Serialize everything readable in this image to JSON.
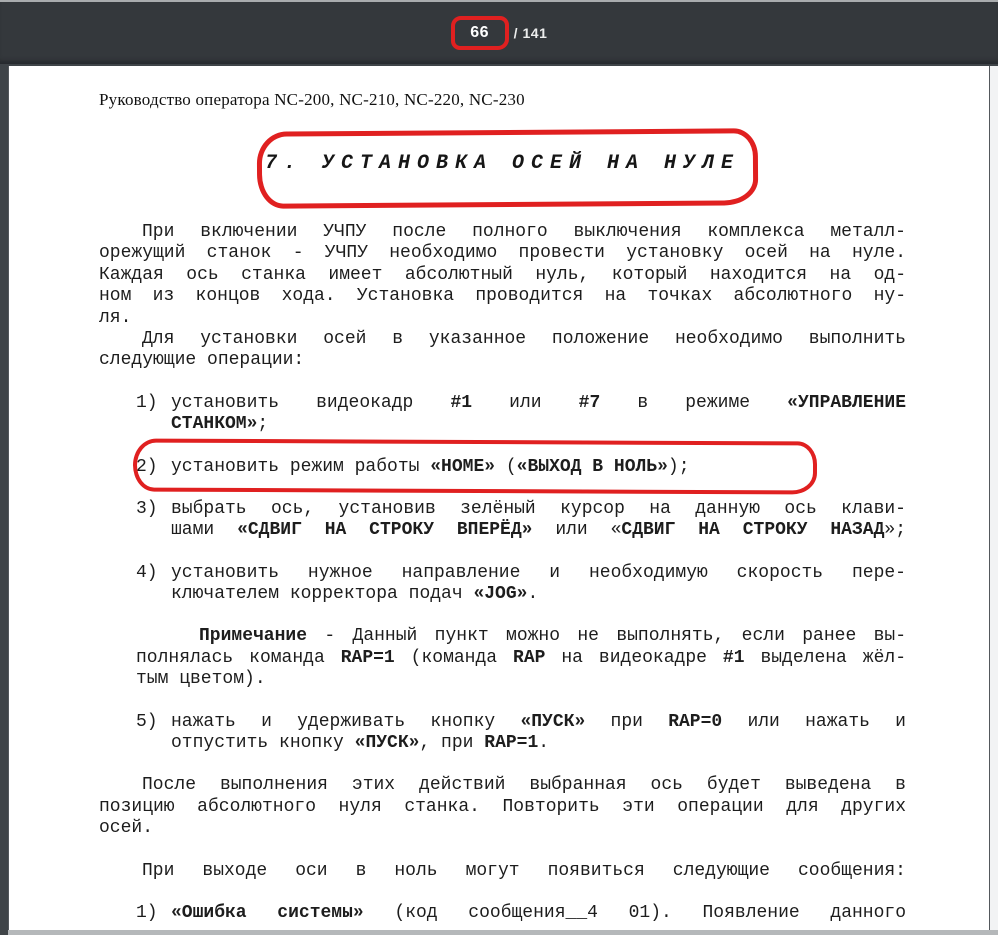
{
  "toolbar": {
    "current_page": "66",
    "page_separator": "/",
    "total_pages": "141"
  },
  "annotation_color": "#e02020",
  "page": {
    "header": "Руководство оператора NC-200, NC-210, NC-220, NC-230",
    "title": "7.  УСТАНОВКА ОСЕЙ НА НУЛЕ",
    "blocks": [
      {
        "type": "para",
        "indent": true,
        "gap": false,
        "lines": [
          {
            "j": true,
            "r": [
              [
                "При включении УЧПУ после полного выключения комплекса металл-",
                0
              ]
            ]
          },
          {
            "j": true,
            "r": [
              [
                "орежущий станок - УЧПУ необходимо провести установку осей на нуле.",
                0
              ]
            ]
          },
          {
            "j": true,
            "r": [
              [
                "Каждая ось станка имеет абсолютный нуль, который находится на од-",
                0
              ]
            ]
          },
          {
            "j": true,
            "r": [
              [
                "ном из концов хода. Установка проводится на точках абсолютного ну-",
                0
              ]
            ]
          },
          {
            "j": false,
            "r": [
              [
                "ля.",
                0
              ]
            ]
          }
        ]
      },
      {
        "type": "para",
        "indent": true,
        "gap": false,
        "lines": [
          {
            "j": true,
            "r": [
              [
                "Для установки осей в указанное положение необходимо выполнить",
                0
              ]
            ]
          },
          {
            "j": false,
            "r": [
              [
                "следующие операции:",
                0
              ]
            ]
          }
        ]
      },
      {
        "type": "list",
        "marker": "1)",
        "gap": true,
        "lines": [
          {
            "j": true,
            "r": [
              [
                "установить видеокадр ",
                0
              ],
              [
                "#1",
                1
              ],
              [
                " или ",
                0
              ],
              [
                "#7",
                1
              ],
              [
                " в режиме ",
                0
              ],
              [
                "«УПРАВЛЕНИЕ",
                1
              ]
            ]
          },
          {
            "j": false,
            "r": [
              [
                "СТАНКОМ»",
                1
              ],
              [
                ";",
                0
              ]
            ]
          }
        ]
      },
      {
        "type": "list",
        "marker": "2)",
        "gap": true,
        "lines": [
          {
            "j": false,
            "r": [
              [
                "установить режим работы ",
                0
              ],
              [
                "«HOME»",
                1
              ],
              [
                " (",
                0
              ],
              [
                "«ВЫХОД В НОЛЬ»",
                1
              ],
              [
                ");",
                0
              ]
            ]
          }
        ]
      },
      {
        "type": "list",
        "marker": "3)",
        "gap": true,
        "lines": [
          {
            "j": true,
            "r": [
              [
                "выбрать ось, установив зелёный курсор на данную ось клави-",
                0
              ]
            ]
          },
          {
            "j": true,
            "r": [
              [
                "шами ",
                0
              ],
              [
                "«СДВИГ НА СТРОКУ ВПЕРЁД»",
                1
              ],
              [
                " или «",
                0
              ],
              [
                "СДВИГ НА СТРОКУ НАЗАД",
                1
              ],
              [
                "»;",
                0
              ]
            ]
          }
        ]
      },
      {
        "type": "list",
        "marker": "4)",
        "gap": true,
        "lines": [
          {
            "j": true,
            "r": [
              [
                "установить нужное направление и необходимую скорость пере-",
                0
              ]
            ]
          },
          {
            "j": false,
            "r": [
              [
                "ключателем корректора подач ",
                0
              ],
              [
                "«JOG»",
                1
              ],
              [
                ".",
                0
              ]
            ]
          }
        ]
      },
      {
        "type": "note",
        "gap": true,
        "lines": [
          {
            "j": true,
            "r": [
              [
                "Примечание",
                1
              ],
              [
                " - Данный пункт можно не выполнять, если ранее вы-",
                0
              ]
            ]
          },
          {
            "j": true,
            "r": [
              [
                "полнялась команда ",
                0
              ],
              [
                "RAP=1",
                1
              ],
              [
                " (команда ",
                0
              ],
              [
                "RAP",
                1
              ],
              [
                " на видеокадре ",
                0
              ],
              [
                "#1",
                1
              ],
              [
                " выделена жёл-",
                0
              ]
            ]
          },
          {
            "j": false,
            "r": [
              [
                "тым цветом).",
                0
              ]
            ]
          }
        ]
      },
      {
        "type": "list",
        "marker": "5)",
        "gap": true,
        "lines": [
          {
            "j": true,
            "r": [
              [
                "нажать и удерживать кнопку ",
                0
              ],
              [
                "«ПУСК»",
                1
              ],
              [
                " при ",
                0
              ],
              [
                "RAP=0",
                1
              ],
              [
                " или нажать и",
                0
              ]
            ]
          },
          {
            "j": false,
            "r": [
              [
                "отпустить кнопку ",
                0
              ],
              [
                "«ПУСК»",
                1
              ],
              [
                ", при ",
                0
              ],
              [
                "RAP=1",
                1
              ],
              [
                ".",
                0
              ]
            ]
          }
        ]
      },
      {
        "type": "para",
        "indent": true,
        "gap": true,
        "lines": [
          {
            "j": true,
            "r": [
              [
                "После выполнения этих действий выбранная ось будет выведена в",
                0
              ]
            ]
          },
          {
            "j": true,
            "r": [
              [
                "позицию абсолютного нуля станка. Повторить эти операции для других",
                0
              ]
            ]
          },
          {
            "j": false,
            "r": [
              [
                "осей.",
                0
              ]
            ]
          }
        ]
      },
      {
        "type": "para",
        "indent": true,
        "gap": true,
        "lines": [
          {
            "j": true,
            "r": [
              [
                "При выходе оси в ноль могут появиться следующие сообщения:",
                0
              ]
            ]
          }
        ]
      },
      {
        "type": "list",
        "marker": "1)",
        "gap": true,
        "lines": [
          {
            "j": true,
            "r": [
              [
                "«Ошибка системы»",
                1
              ],
              [
                " (код сообщения",
                0
              ],
              [
                "__",
                0
              ],
              [
                "4 01). Появление данного",
                0
              ]
            ]
          }
        ]
      }
    ]
  }
}
